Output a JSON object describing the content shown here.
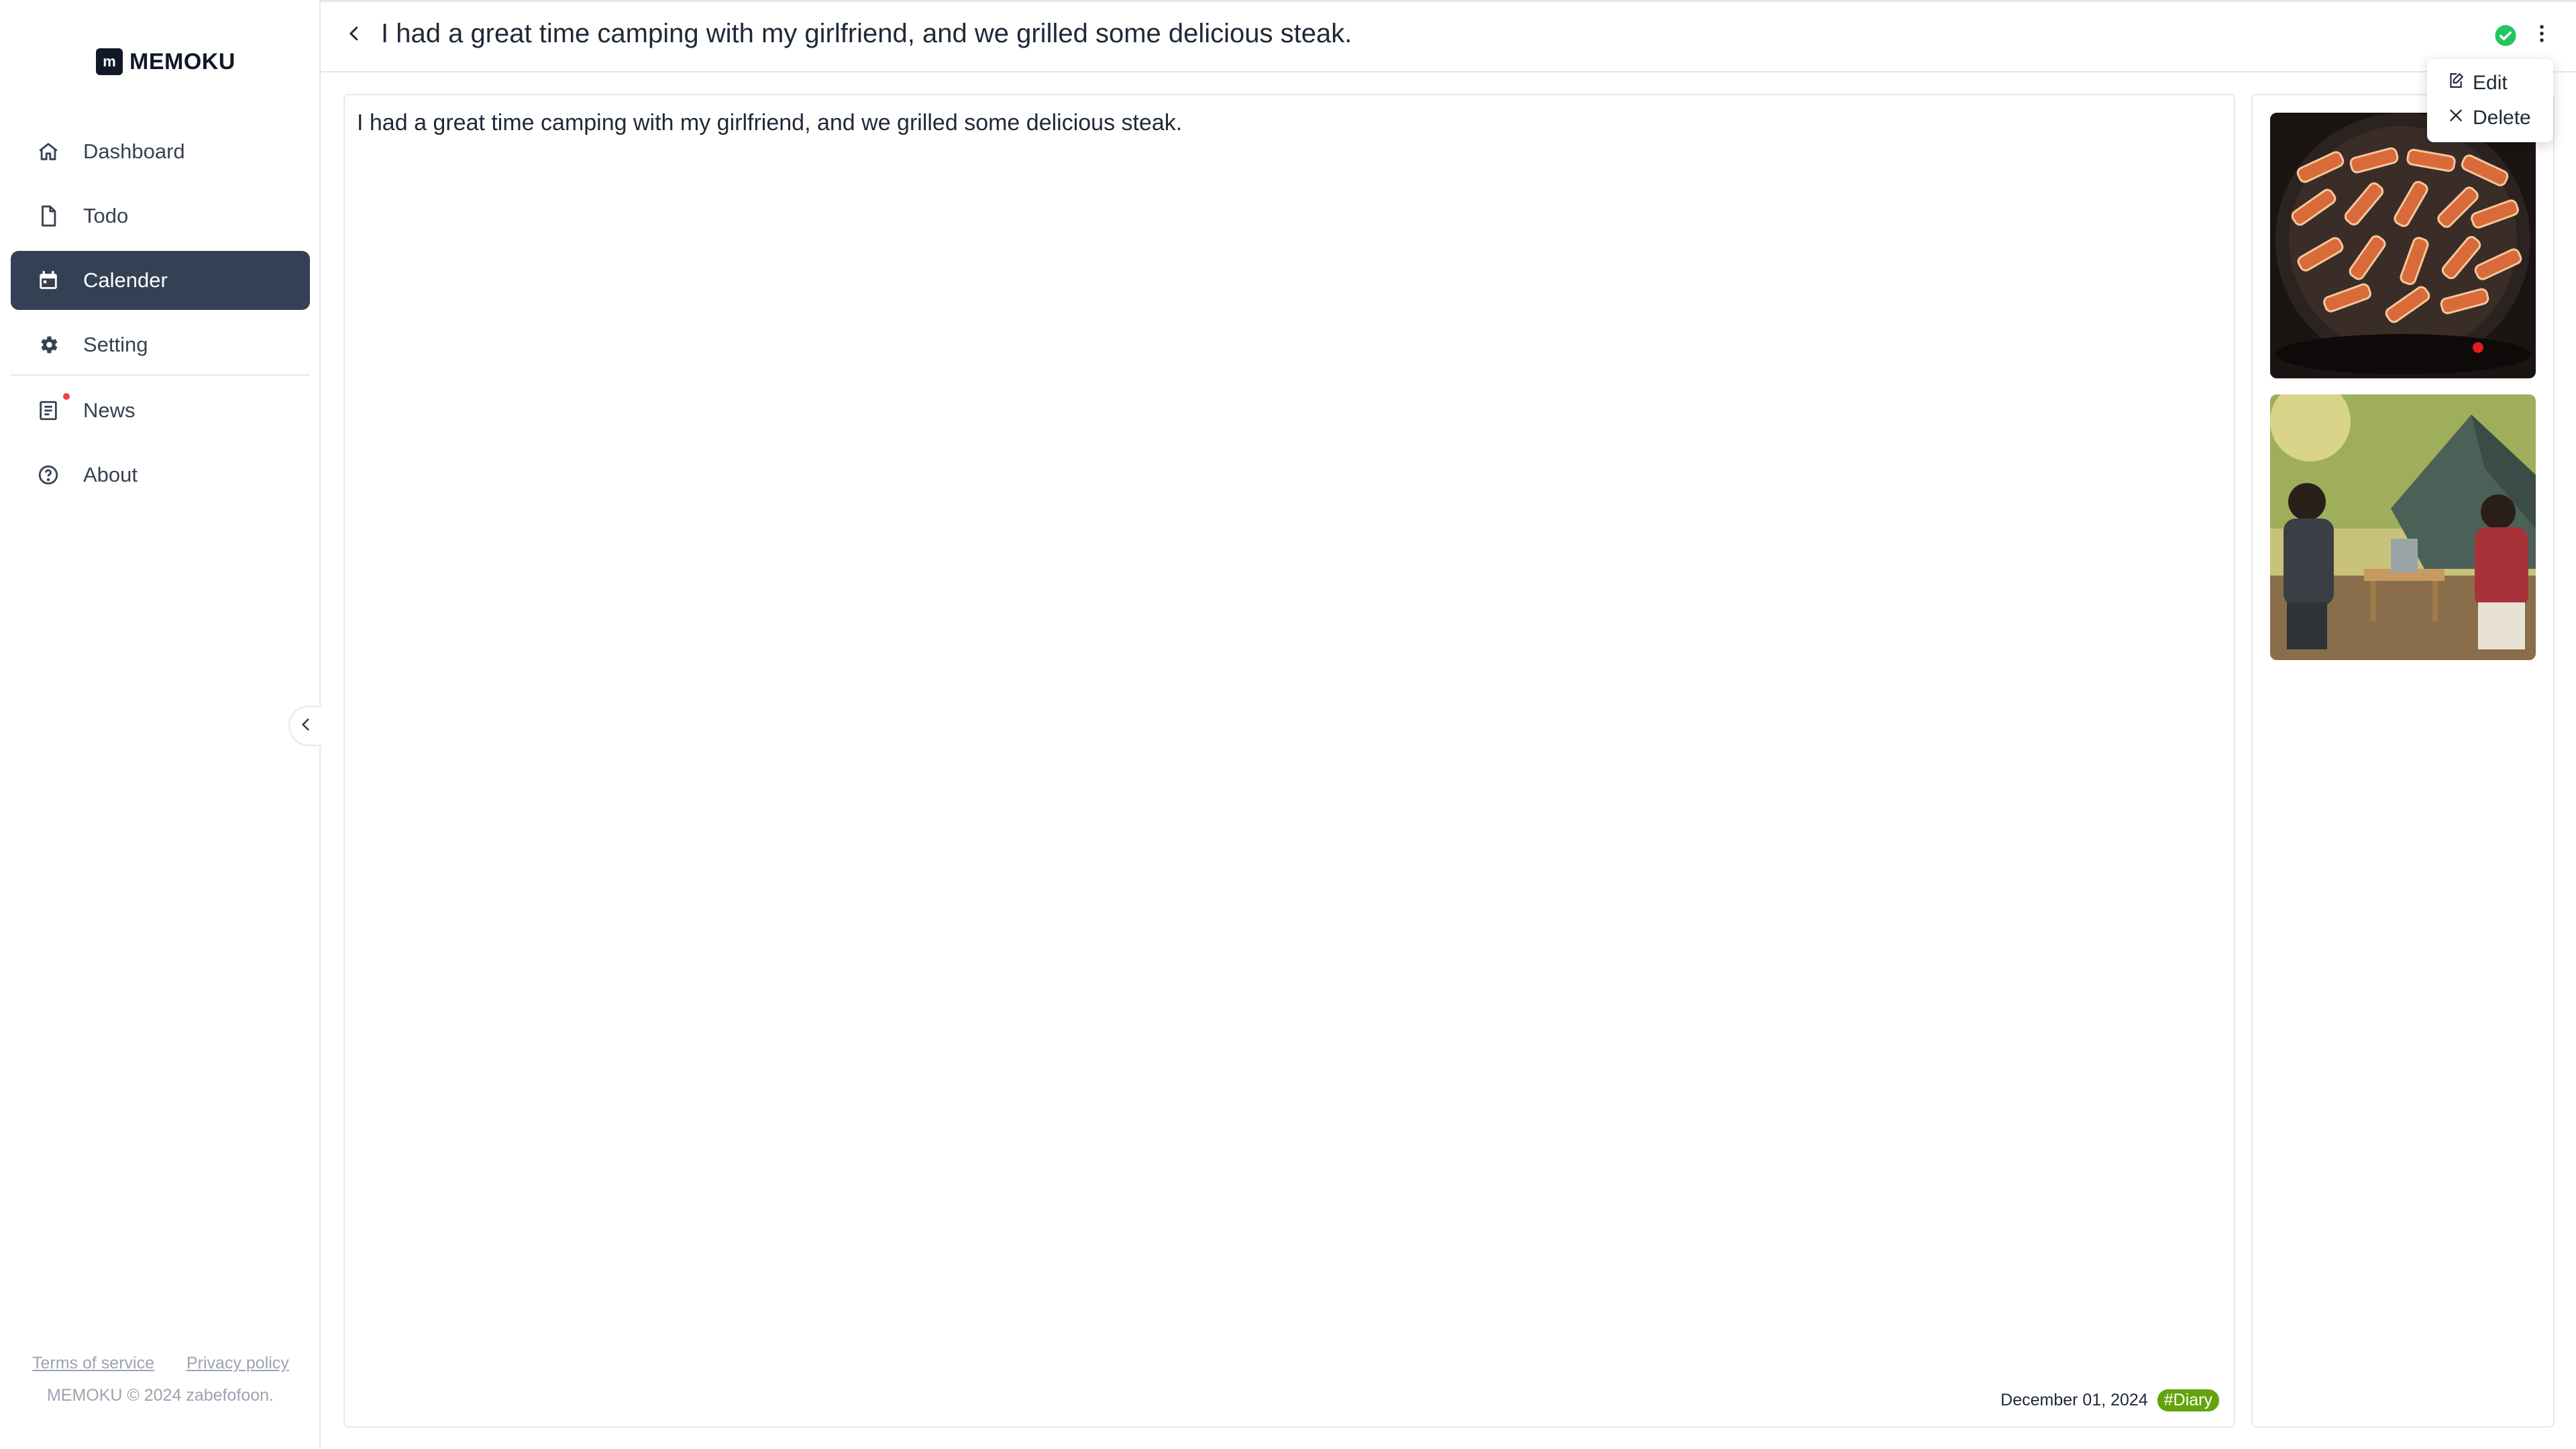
{
  "app": {
    "logo_mark": "m",
    "name": "MEMOKU"
  },
  "sidebar": {
    "items": [
      {
        "label": "Dashboard",
        "icon": "home-icon"
      },
      {
        "label": "Todo",
        "icon": "file-icon"
      },
      {
        "label": "Calender",
        "icon": "calendar-icon",
        "active": true
      },
      {
        "label": "Setting",
        "icon": "gear-icon"
      },
      {
        "label": "News",
        "icon": "newspaper-icon",
        "has_notification": true
      },
      {
        "label": "About",
        "icon": "help-circle-icon"
      }
    ],
    "footer": {
      "terms": "Terms of service",
      "privacy": "Privacy policy",
      "copyright": "MEMOKU © 2024 zabefofoon."
    }
  },
  "header": {
    "title": "I had a great time camping with my girlfriend, and we grilled some delicious steak.",
    "status_icon": "check-circle-icon",
    "status_color": "#22c55e"
  },
  "entry": {
    "text": "I had a great time camping with my girlfriend, and we grilled some delicious steak.",
    "date": "December 01, 2024",
    "tag": "#Diary",
    "tag_color": "#65a30d"
  },
  "dropdown": {
    "edit_label": "Edit",
    "delete_label": "Delete"
  },
  "images": [
    {
      "depicts": "grilled steak on round grill"
    },
    {
      "depicts": "couple camping near tent"
    }
  ],
  "colors": {
    "active_nav": "#334155",
    "accent": "#22c55e"
  }
}
